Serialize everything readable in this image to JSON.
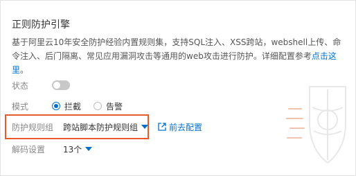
{
  "card": {
    "title": "正则防护引擎",
    "description": "基于阿里云10年安全防护经验内置规则集，支持SQL注入、XSS跨站，webshell上传、命令注入、后门隔离、常见应用漏洞攻击等通用的web攻击进行防护。详细配置参考",
    "description_link": "点击这里",
    "description_end": "。"
  },
  "status": {
    "label": "状态",
    "enabled": false
  },
  "mode": {
    "label": "模式",
    "options": [
      {
        "label": "拦截",
        "checked": true
      },
      {
        "label": "告警",
        "checked": false
      }
    ]
  },
  "rule_group": {
    "label": "防护规则组",
    "selected": "跨站脚本防护规则组",
    "goto_link": "前去配置"
  },
  "decode": {
    "label": "解码设置",
    "selected": "13个"
  },
  "colors": {
    "accent": "#0070cc",
    "highlight_border": "#e85a2b"
  }
}
